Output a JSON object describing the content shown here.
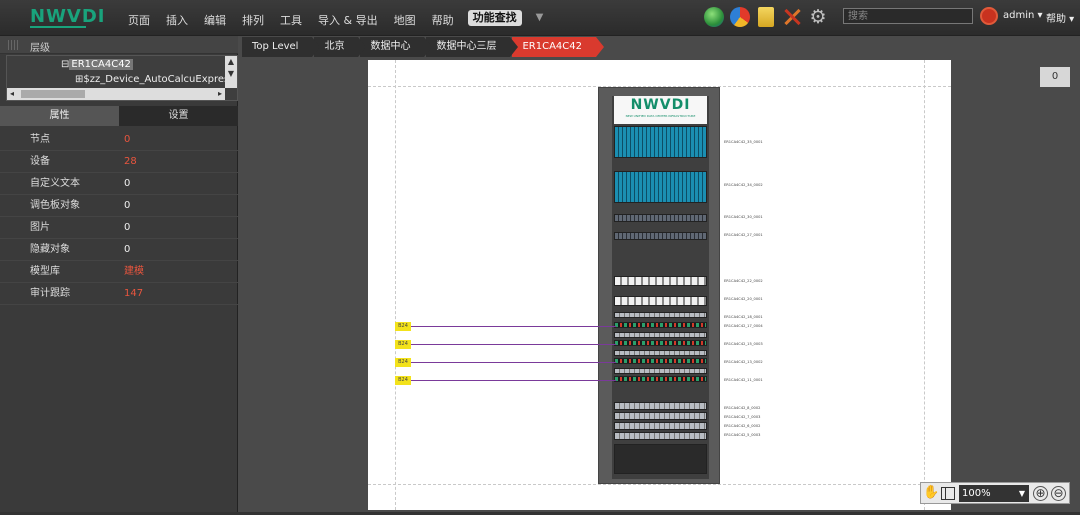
{
  "app": {
    "logo": "NWVDI"
  },
  "menu": {
    "items": [
      "页面",
      "插入",
      "编辑",
      "排列",
      "工具",
      "导入 & 导出",
      "地图",
      "帮助"
    ],
    "active_item": "功能查找",
    "more_glyph": "▼"
  },
  "toolbar": {
    "icons": [
      "globe-icon",
      "chart-icon",
      "note-icon",
      "tools-icon",
      "gear-icon"
    ],
    "search_placeholder": "搜索",
    "user": "admin ▾",
    "help": "帮助 ▾"
  },
  "layer_panel": {
    "title": "层级",
    "tree": [
      {
        "label": "ER1CA4C42",
        "prefix": "⊟",
        "selected": true
      },
      {
        "label": "$zz_Device_AutoCalcuExpress",
        "prefix": "⊞",
        "selected": false
      }
    ]
  },
  "properties": {
    "tab_attr": "属性",
    "tab_settings": "设置",
    "rows": [
      {
        "key": "节点",
        "value": "0",
        "highlight": true
      },
      {
        "key": "设备",
        "value": "28",
        "highlight": true
      },
      {
        "key": "自定义文本",
        "value": "0",
        "highlight": false
      },
      {
        "key": "调色板对象",
        "value": "0",
        "highlight": false
      },
      {
        "key": "图片",
        "value": "0",
        "highlight": false
      },
      {
        "key": "隐藏对象",
        "value": "0",
        "highlight": false
      },
      {
        "key": "模型库",
        "value": "建模",
        "highlight": true
      },
      {
        "key": "审计跟踪",
        "value": "147",
        "highlight": true
      }
    ]
  },
  "breadcrumb": [
    "Top Level",
    "北京",
    "数据中心",
    "数据中心三层",
    "ER1CA4C42"
  ],
  "canvas": {
    "count_badge": "0",
    "rack_logo": "NWVDI",
    "rack_logo_sub": "NEW UNIFIED DATA CENTER INFRASTRUCTURE",
    "port_tags": [
      "B24",
      "B24",
      "B24",
      "B24"
    ],
    "device_labels": [
      "ER1CA4C42_35_0001",
      "ER1CA4C42_34_0002",
      "ER1CA4C42_30_0001",
      "ER1CA4C42_27_0001",
      "ER1CA4C42_22_0002",
      "ER1CA4C42_20_0001",
      "ER1CA4C42_18_0001",
      "ER1CA4C42_17_0004",
      "ER1CA4C42_15_0003",
      "ER1CA4C42_13_0002",
      "ER1CA4C42_11_0001",
      "ER1CA4C42_8_0002",
      "ER1CA4C42_7_0003",
      "ER1CA4C42_6_0002",
      "ER1CA4C42_5_0003"
    ]
  },
  "zoom": {
    "level": "100%",
    "caret": "▼",
    "zoom_in": "⊕",
    "zoom_out": "⊖"
  },
  "colors": {
    "brand": "#19a37c",
    "accent_red": "#d93a2e",
    "link_purple": "#7a3a9a",
    "tag_yellow": "#f3e21b"
  }
}
